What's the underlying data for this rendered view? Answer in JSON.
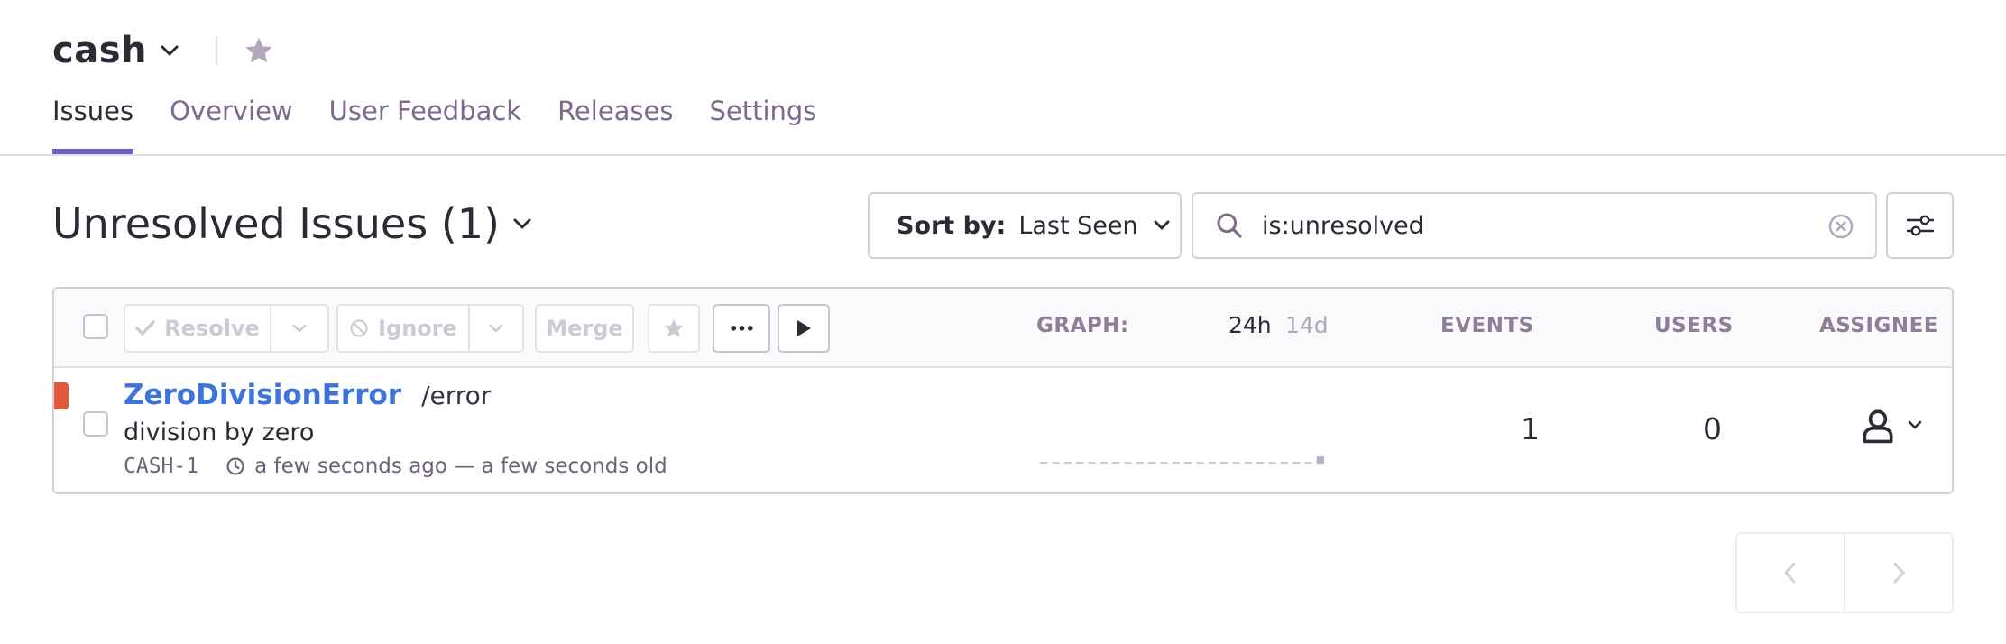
{
  "header": {
    "project_name": "cash",
    "tabs": [
      {
        "label": "Issues",
        "active": true
      },
      {
        "label": "Overview",
        "active": false
      },
      {
        "label": "User Feedback",
        "active": false
      },
      {
        "label": "Releases",
        "active": false
      },
      {
        "label": "Settings",
        "active": false
      }
    ]
  },
  "title_bar": {
    "title": "Unresolved Issues",
    "count": "(1)",
    "sort_label": "Sort by:",
    "sort_value": "Last Seen",
    "search_value": "is:unresolved"
  },
  "toolbar": {
    "resolve_label": "Resolve",
    "ignore_label": "Ignore",
    "merge_label": "Merge",
    "more_label": "•••",
    "graph_label": "GRAPH:",
    "period_24h": "24h",
    "period_14d": "14d",
    "events_label": "EVENTS",
    "users_label": "USERS",
    "assignee_label": "ASSIGNEE"
  },
  "issues": [
    {
      "type": "ZeroDivisionError",
      "culprit": "/error",
      "message": "division by zero",
      "short_id": "CASH-1",
      "time_text": "a few seconds ago — a few seconds old",
      "events": "1",
      "users": "0",
      "level_color": "#e0593a",
      "sparkline": [
        0,
        0,
        0,
        0,
        0,
        0,
        0,
        0,
        0,
        0,
        0,
        0,
        0,
        0,
        0,
        0,
        0,
        0,
        0,
        0,
        0,
        0,
        0,
        1
      ]
    }
  ],
  "colors": {
    "accent": "#6c5fc7",
    "link": "#3d74db",
    "muted": "#7c6a8e",
    "border": "#d6d0dc"
  },
  "icons": {
    "project_chevron": "chevron-down-icon",
    "star": "star-icon",
    "search": "search-icon",
    "clear": "close-circle-icon",
    "filter": "sliders-icon",
    "play": "play-icon",
    "clock": "clock-icon",
    "assignee": "user-icon",
    "prev": "chevron-left-icon",
    "next": "chevron-right-icon"
  }
}
